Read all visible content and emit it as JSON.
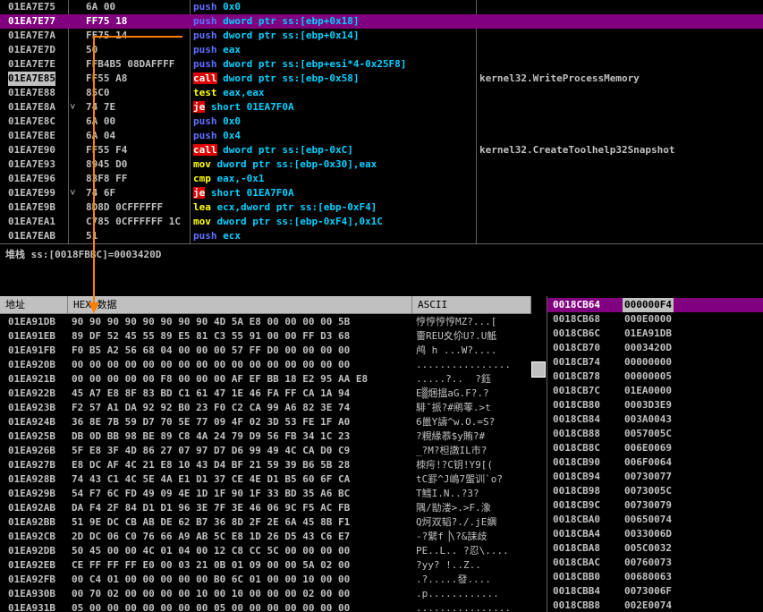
{
  "colors": {
    "selection": "#800080",
    "call_bg": "#e00000",
    "arrow": "#ff8000"
  },
  "disasm": {
    "rows": [
      {
        "addr": "01EA7E75",
        "hex": "6A 00",
        "cmd": "push",
        "ops": "0x0"
      },
      {
        "addr": "01EA7E77",
        "hex": "FF75 18",
        "cmd": "push",
        "ops": "dword ptr ss:[ebp+0x18]",
        "selected": true
      },
      {
        "addr": "01EA7E7A",
        "hex": "FF75 14",
        "cmd": "push",
        "ops": "dword ptr ss:[ebp+0x14]"
      },
      {
        "addr": "01EA7E7D",
        "hex": "50",
        "cmd": "push",
        "ops": "eax"
      },
      {
        "addr": "01EA7E7E",
        "hex": "FFB4B5 08DAFFFF",
        "cmd": "push",
        "ops": "dword ptr ss:[ebp+esi*4-0x25F8]"
      },
      {
        "addr": "01EA7E85",
        "hex": "FF55 A8",
        "cmd": "call",
        "ops": "dword ptr ss:[ebp-0x58]",
        "comment": "kernel32.WriteProcessMemory",
        "current": true
      },
      {
        "addr": "01EA7E88",
        "hex": "85C0",
        "cmd": "test",
        "ops": "eax,eax"
      },
      {
        "addr": "01EA7E8A",
        "hex": "74 7E",
        "cmd": "je",
        "ops": "short 01EA7F0A",
        "marker": "˅"
      },
      {
        "addr": "01EA7E8C",
        "hex": "6A 00",
        "cmd": "push",
        "ops": "0x0"
      },
      {
        "addr": "01EA7E8E",
        "hex": "6A 04",
        "cmd": "push",
        "ops": "0x4"
      },
      {
        "addr": "01EA7E90",
        "hex": "FF55 F4",
        "cmd": "call",
        "ops": "dword ptr ss:[ebp-0xC]",
        "comment": "kernel32.CreateToolhelp32Snapshot"
      },
      {
        "addr": "01EA7E93",
        "hex": "8945 D0",
        "cmd": "mov",
        "ops": "dword ptr ss:[ebp-0x30],eax"
      },
      {
        "addr": "01EA7E96",
        "hex": "83F8 FF",
        "cmd": "cmp",
        "ops": "eax,-0x1"
      },
      {
        "addr": "01EA7E99",
        "hex": "74 6F",
        "cmd": "je",
        "ops": "short 01EA7F0A",
        "marker": "˅"
      },
      {
        "addr": "01EA7E9B",
        "hex": "8D8D 0CFFFFFF",
        "cmd": "lea",
        "ops": "ecx,dword ptr ss:[ebp-0xF4]"
      },
      {
        "addr": "01EA7EA1",
        "hex": "C785 0CFFFFFF 1C",
        "cmd": "mov",
        "ops": "dword ptr ss:[ebp-0xF4],0x1C"
      },
      {
        "addr": "01EA7EAB",
        "hex": "51",
        "cmd": "push",
        "ops": "ecx"
      }
    ]
  },
  "info": {
    "text": "堆栈 ss:[0018FBBC]=0003420D"
  },
  "dump": {
    "headers": {
      "addr": "地址",
      "hex": "HEX 数据",
      "ascii": "ASCII"
    },
    "rows": [
      {
        "addr": "01EA91DB",
        "hex": "90 90 90 90 90 90 90 90 4D 5A E8 00 00 00 00 5B",
        "ascii": "悙悙悙悙MZ?...["
      },
      {
        "addr": "01EA91EB",
        "hex": "89 DF 52 45 55 89 E5 81 C3 55 91 00 00 FF D3 68",
        "ascii": "夁REU夊伱U?.U觝"
      },
      {
        "addr": "01EA91FB",
        "hex": "F0 B5 A2 56 68 04 00 00 00 57 FF D0 00 00 00 00",
        "ascii": "鸬 h ...W?...."
      },
      {
        "addr": "01EA920B",
        "hex": "00 00 00 00 00 00 00 00 00 00 00 00 00 00 00 00",
        "ascii": "................"
      },
      {
        "addr": "01EA921B",
        "hex": "00 00 00 00 00 F8 00 00 00 AF EF BB 18 E2 95 AA E8",
        "ascii": ".....?..  ?鈺"
      },
      {
        "addr": "01EA922B",
        "hex": "45 A7 E8 8F 83 BD C1 61 47 1E 46 FA FF CA 1A 94",
        "ascii": "E▒焑搵aG.F?.?"
      },
      {
        "addr": "01EA923B",
        "hex": "F2 57 A1 DA 92 92 B0 23 F0 C2 CA 99 A6 82 3E 74",
        "ascii": "騑ˇ挀?#鹇蕶.>t"
      },
      {
        "addr": "01EA924B",
        "hex": "36 8E 7B 59 D7 70 5E 77 09 4F 02 3D 53 FE 1F A0",
        "ascii": "6巤Y譸^w.O.=S?"
      },
      {
        "addr": "01EA925B",
        "hex": "DB 0D BB 98 BE 89 C8 4A 24 79 D9 56 FB 34 1C 23",
        "ascii": "?粯緣菾$y賄?#"
      },
      {
        "addr": "01EA926B",
        "hex": "5F E8 3F 4D 86 27 07 97 D7 D6 99 49 4C CA D0 C9",
        "ascii": "_?M?柦譈IL市?"
      },
      {
        "addr": "01EA927B",
        "hex": "E8 DC AF 4C 21 E8 10 43 D4 BF 21 59 39 B6 5B 28",
        "ascii": "栜疞!?C钥!Y9[("
      },
      {
        "addr": "01EA928B",
        "hex": "74 43 C1 4C 5E 4A E1 D1 37 CE 4E D1 B5 60 6F CA",
        "ascii": "tC罫^J嶋7蜰训`o?"
      },
      {
        "addr": "01EA929B",
        "hex": "54 F7 6C FD 49 09 4E 1D 1F 90 1F 33 BD 35 A6 BC",
        "ascii": "T鱈I.N..?3?"
      },
      {
        "addr": "01EA92AB",
        "hex": "DA F4 2F 84 D1 D1 96 3E 7F 3E 46 06 9C F5 AC FB",
        "ascii": "隅/勓溇>.>F.潒"
      },
      {
        "addr": "01EA92BB",
        "hex": "51 9E DC CB AB DE 62 B7 36 8D 2F 2E 6A 45 8B F1",
        "ascii": "Q炣双韬?./.jE嬹"
      },
      {
        "addr": "01EA92CB",
        "hex": "2D DC 06 C0 76 66 A9 AB 5C E8 1D 26 D5 43 C6 E7",
        "ascii": "-?繴f▕\\?&誄歧"
      },
      {
        "addr": "01EA92DB",
        "hex": "50 45 00 00 4C 01 04 00 12 C8 CC 5C 00 00 00 00",
        "ascii": "PE..L.. ?忍\\...."
      },
      {
        "addr": "01EA92EB",
        "hex": "CE FF FF FF E0 00 03 21 0B 01 09 00 00 5A 02 00",
        "ascii": "?yy? !..Z.."
      },
      {
        "addr": "01EA92FB",
        "hex": "00 C4 01 00 00 00 00 00 B0 6C 01 00 00 10 00 00",
        "ascii": ".?.....發...."
      },
      {
        "addr": "01EA930B",
        "hex": "00 70 02 00 00 00 00 10 00 10 00 00 00 02 00 00",
        "ascii": ".p............"
      },
      {
        "addr": "01EA931B",
        "hex": "05 00 00 00 00 00 00 00 05 00 00 00 00 00 00 00",
        "ascii": "................"
      }
    ]
  },
  "stack": {
    "rows": [
      {
        "addr": "0018CB64",
        "val": "000000F4",
        "selected": true
      },
      {
        "addr": "0018CB68",
        "val": "000E0000"
      },
      {
        "addr": "0018CB6C",
        "val": "01EA91DB"
      },
      {
        "addr": "0018CB70",
        "val": "0003420D"
      },
      {
        "addr": "0018CB74",
        "val": "00000000"
      },
      {
        "addr": "0018CB78",
        "val": "00000005"
      },
      {
        "addr": "0018CB7C",
        "val": "01EA0000"
      },
      {
        "addr": "0018CB80",
        "val": "0003D3E9"
      },
      {
        "addr": "0018CB84",
        "val": "003A0043"
      },
      {
        "addr": "0018CB88",
        "val": "0057005C"
      },
      {
        "addr": "0018CB8C",
        "val": "006E0069"
      },
      {
        "addr": "0018CB90",
        "val": "006F0064"
      },
      {
        "addr": "0018CB94",
        "val": "00730077"
      },
      {
        "addr": "0018CB98",
        "val": "0073005C"
      },
      {
        "addr": "0018CB9C",
        "val": "00730079"
      },
      {
        "addr": "0018CBA0",
        "val": "00650074"
      },
      {
        "addr": "0018CBA4",
        "val": "0033006D"
      },
      {
        "addr": "0018CBA8",
        "val": "005C0032"
      },
      {
        "addr": "0018CBAC",
        "val": "00760073"
      },
      {
        "addr": "0018CBB0",
        "val": "00680063"
      },
      {
        "addr": "0018CBB4",
        "val": "0073006F"
      },
      {
        "addr": "0018CBB8",
        "val": "002E0074"
      }
    ]
  }
}
